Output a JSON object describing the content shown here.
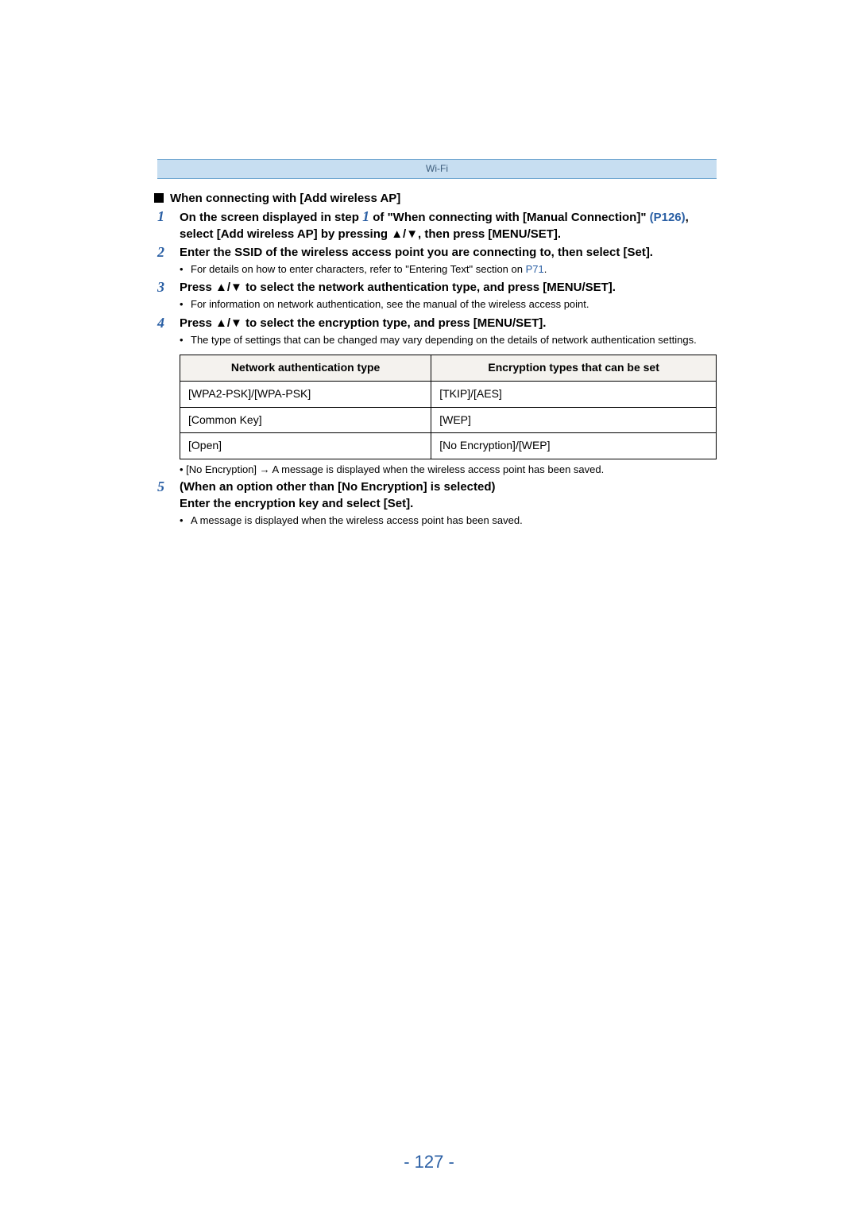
{
  "banner": {
    "label": "Wi-Fi"
  },
  "heading": "When connecting with [Add wireless AP]",
  "steps": [
    {
      "num": "1",
      "line_parts": {
        "prefix": "On the screen displayed in step ",
        "inline_num": "1",
        "mid": " of \"When connecting with [Manual Connection]\" ",
        "link": "(P126)",
        "suffix": ", select [Add wireless AP] by pressing ▲/▼, then press [MENU/SET]."
      }
    },
    {
      "num": "2",
      "main": "Enter the SSID of the wireless access point you are connecting to, then select [Set].",
      "bullets": [
        {
          "prefix": "For details on how to enter characters, refer to \"Entering Text\" section on ",
          "link": "P71",
          "suffix": "."
        }
      ]
    },
    {
      "num": "3",
      "main": "Press ▲/▼ to select the network authentication type, and press [MENU/SET].",
      "bullets": [
        {
          "text": "For information on network authentication, see the manual of the wireless access point."
        }
      ]
    },
    {
      "num": "4",
      "main": "Press ▲/▼ to select the encryption type, and press [MENU/SET].",
      "bullets": [
        {
          "text": "The type of settings that can be changed may vary depending on the details of network authentication settings."
        }
      ]
    }
  ],
  "table": {
    "headers": [
      "Network authentication type",
      "Encryption types that can be set"
    ],
    "rows": [
      [
        "[WPA2-PSK]/[WPA-PSK]",
        "[TKIP]/[AES]"
      ],
      [
        "[Common Key]",
        "[WEP]"
      ],
      [
        "[Open]",
        "[No Encryption]/[WEP]"
      ]
    ]
  },
  "post_table_note": "[No Encryption] → A message is displayed when the wireless access point has been saved.",
  "step5": {
    "num": "5",
    "line1": "(When an option other than [No Encryption] is selected)",
    "line2": "Enter the encryption key and select [Set].",
    "bullet": "A message is displayed when the wireless access point has been saved."
  },
  "page_number": "- 127 -"
}
